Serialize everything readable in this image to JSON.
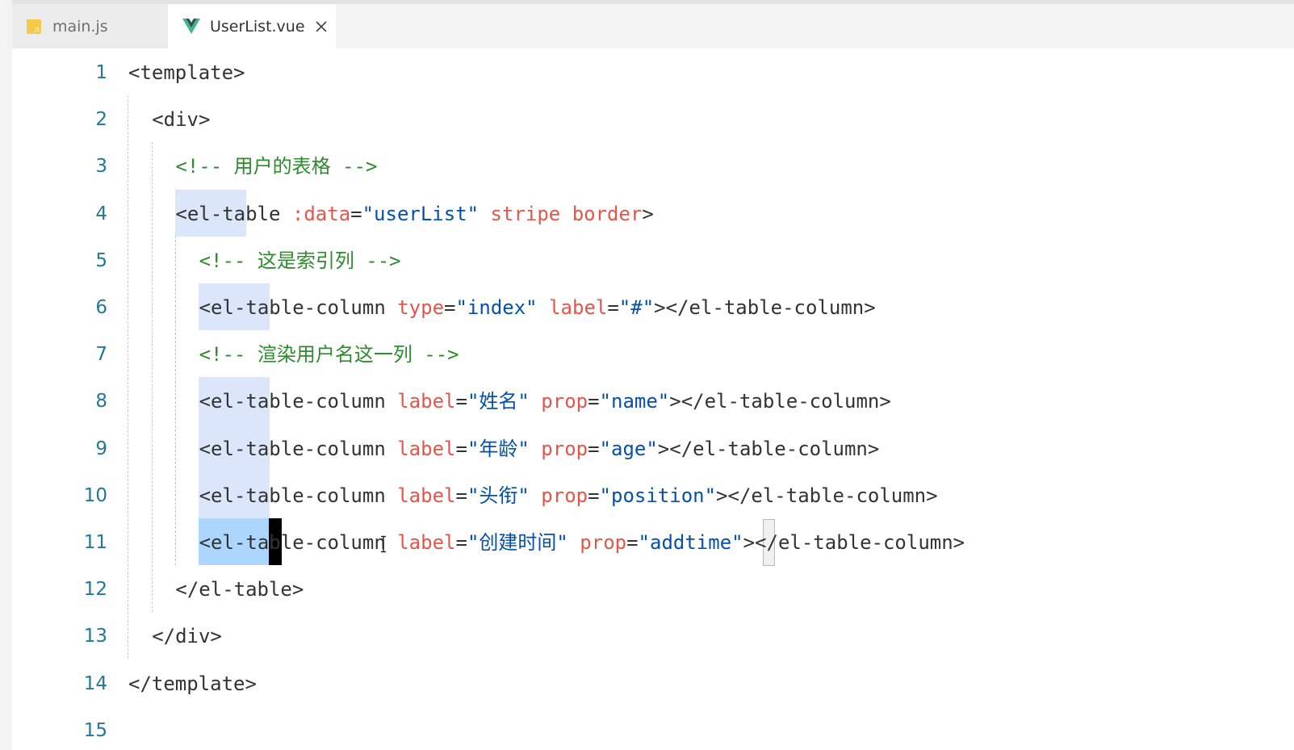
{
  "tabs": [
    {
      "label": "main.js",
      "icon": "js-file-icon",
      "active": false
    },
    {
      "label": "UserList.vue",
      "icon": "vue-file-icon",
      "active": true,
      "close": "close-icon"
    }
  ],
  "colors": {
    "tag": "#333333",
    "attribute": "#e45649",
    "string": "#0550ae",
    "comment": "#2e8b2e",
    "line_number": "#237893"
  },
  "editor": {
    "lines": [
      {
        "n": "1",
        "parts": [
          {
            "t": "<template>",
            "c": "tag"
          }
        ]
      },
      {
        "n": "2",
        "parts": [
          {
            "t": "<div>",
            "c": "tag"
          }
        ]
      },
      {
        "n": "3",
        "parts": [
          {
            "t": "<!-- 用户的表格 -->",
            "c": "cmt"
          }
        ]
      },
      {
        "n": "4",
        "parts": [
          {
            "t": "<el-table ",
            "c": "tag"
          },
          {
            "t": ":data",
            "c": "attr"
          },
          {
            "t": "=",
            "c": "eq"
          },
          {
            "t": "\"userList\"",
            "c": "str"
          },
          {
            "t": " ",
            "c": "tag"
          },
          {
            "t": "stripe",
            "c": "attr"
          },
          {
            "t": " ",
            "c": "tag"
          },
          {
            "t": "border",
            "c": "attr"
          },
          {
            "t": ">",
            "c": "tag"
          }
        ]
      },
      {
        "n": "5",
        "parts": [
          {
            "t": "<!-- 这是索引列 -->",
            "c": "cmt"
          }
        ]
      },
      {
        "n": "6",
        "parts": [
          {
            "t": "<el-table-column ",
            "c": "tag"
          },
          {
            "t": "type",
            "c": "attr"
          },
          {
            "t": "=",
            "c": "eq"
          },
          {
            "t": "\"index\"",
            "c": "str"
          },
          {
            "t": " ",
            "c": "tag"
          },
          {
            "t": "label",
            "c": "attr"
          },
          {
            "t": "=",
            "c": "eq"
          },
          {
            "t": "\"#\"",
            "c": "str"
          },
          {
            "t": "></el-table-column>",
            "c": "tag"
          }
        ]
      },
      {
        "n": "7",
        "parts": [
          {
            "t": "<!-- 渲染用户名这一列 -->",
            "c": "cmt"
          }
        ]
      },
      {
        "n": "8",
        "parts": [
          {
            "t": "<el-table-column ",
            "c": "tag"
          },
          {
            "t": "label",
            "c": "attr"
          },
          {
            "t": "=",
            "c": "eq"
          },
          {
            "t": "\"姓名\"",
            "c": "str"
          },
          {
            "t": " ",
            "c": "tag"
          },
          {
            "t": "prop",
            "c": "attr"
          },
          {
            "t": "=",
            "c": "eq"
          },
          {
            "t": "\"name\"",
            "c": "str"
          },
          {
            "t": "></el-table-column>",
            "c": "tag"
          }
        ]
      },
      {
        "n": "9",
        "parts": [
          {
            "t": "<el-table-column ",
            "c": "tag"
          },
          {
            "t": "label",
            "c": "attr"
          },
          {
            "t": "=",
            "c": "eq"
          },
          {
            "t": "\"年龄\"",
            "c": "str"
          },
          {
            "t": " ",
            "c": "tag"
          },
          {
            "t": "prop",
            "c": "attr"
          },
          {
            "t": "=",
            "c": "eq"
          },
          {
            "t": "\"age\"",
            "c": "str"
          },
          {
            "t": "></el-table-column>",
            "c": "tag"
          }
        ]
      },
      {
        "n": "10",
        "parts": [
          {
            "t": "<el-table-column ",
            "c": "tag"
          },
          {
            "t": "label",
            "c": "attr"
          },
          {
            "t": "=",
            "c": "eq"
          },
          {
            "t": "\"头衔\"",
            "c": "str"
          },
          {
            "t": " ",
            "c": "tag"
          },
          {
            "t": "prop",
            "c": "attr"
          },
          {
            "t": "=",
            "c": "eq"
          },
          {
            "t": "\"position\"",
            "c": "str"
          },
          {
            "t": "></el-table-column>",
            "c": "tag"
          }
        ]
      },
      {
        "n": "11",
        "parts": [
          {
            "t": "<el-table-column ",
            "c": "tag"
          },
          {
            "t": "label",
            "c": "attr"
          },
          {
            "t": "=",
            "c": "eq"
          },
          {
            "t": "\"创建时间\"",
            "c": "str"
          },
          {
            "t": " ",
            "c": "tag"
          },
          {
            "t": "prop",
            "c": "attr"
          },
          {
            "t": "=",
            "c": "eq"
          },
          {
            "t": "\"addtime\"",
            "c": "str"
          },
          {
            "t": "></el-table-column>",
            "c": "tag"
          }
        ]
      },
      {
        "n": "12",
        "parts": [
          {
            "t": "</el-table>",
            "c": "tag"
          }
        ]
      },
      {
        "n": "13",
        "parts": [
          {
            "t": "</div>",
            "c": "tag"
          }
        ]
      },
      {
        "n": "14",
        "parts": [
          {
            "t": "</template>",
            "c": "tag"
          }
        ]
      },
      {
        "n": "15",
        "parts": []
      }
    ]
  }
}
